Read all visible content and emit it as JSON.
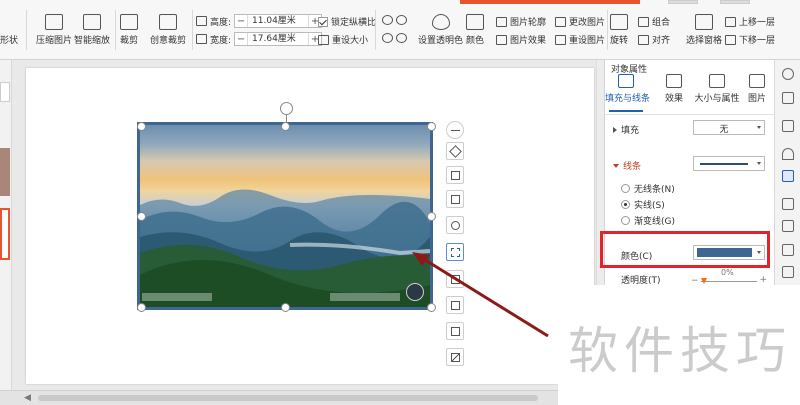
{
  "ribbon": {
    "left_cut_label": "形状",
    "compress_label": "压缩图片",
    "smart_zoom_label": "智能缩放",
    "crop_label": "裁剪",
    "creative_crop_label": "创意裁剪",
    "height_label": "高度:",
    "height_value": "11.04厘米",
    "width_label": "宽度:",
    "width_value": "17.64厘米",
    "lock_ratio_label": "锁定纵横比",
    "reset_size_label": "重设大小",
    "set_transparent_label": "设置透明色",
    "color_label": "颜色",
    "pic_outline_label": "图片轮廓",
    "pic_effect_label": "图片效果",
    "change_pic_label": "更改图片",
    "reset_pic_label": "重设图片",
    "rotate_label": "旋转",
    "group_label": "组合",
    "align_label": "对齐",
    "select_pane_label": "选择窗格",
    "bring_forward_label": "上移一层",
    "send_backward_label": "下移一层"
  },
  "panel": {
    "title": "对象属性",
    "tabs": [
      {
        "label": "填充与线条",
        "icon": "fill-line-icon",
        "active": true
      },
      {
        "label": "效果",
        "icon": "effect-icon",
        "active": false
      },
      {
        "label": "大小与属性",
        "icon": "size-props-icon",
        "active": false
      },
      {
        "label": "图片",
        "icon": "picture-icon",
        "active": false
      }
    ],
    "fill_label": "填充",
    "fill_value": "无",
    "line_label": "线条",
    "line_options": [
      {
        "label": "无线条(N)",
        "checked": false
      },
      {
        "label": "实线(S)",
        "checked": true
      },
      {
        "label": "渐变线(G)",
        "checked": false
      }
    ],
    "color_label": "颜色(C)",
    "color_value": "#3e6690",
    "transparency_label": "透明度(T)",
    "transparency_value": "0%"
  },
  "watermark": "软件技巧",
  "colors": {
    "accent": "#2160b3",
    "image_border": "#3e6690",
    "highlight_box": "#e0242a",
    "arrow": "#8b1a1a"
  }
}
